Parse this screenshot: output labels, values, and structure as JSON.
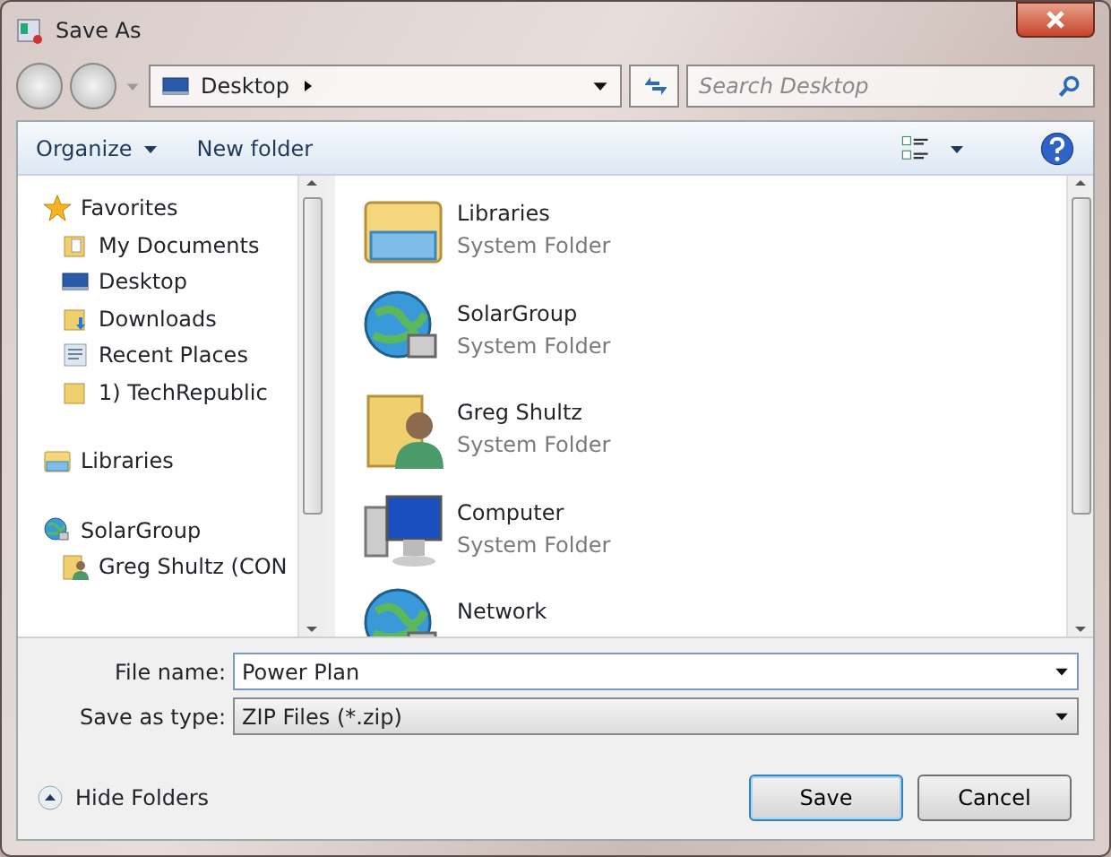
{
  "window": {
    "title": "Save As"
  },
  "address": {
    "location": "Desktop",
    "search_placeholder": "Search Desktop"
  },
  "toolbar": {
    "organize": "Organize",
    "new_folder": "New folder"
  },
  "sidebar": {
    "items": [
      {
        "label": "Favorites",
        "kind": "star",
        "children": [
          {
            "label": "My Documents",
            "kind": "documents"
          },
          {
            "label": "Desktop",
            "kind": "desktop"
          },
          {
            "label": "Downloads",
            "kind": "downloads"
          },
          {
            "label": "Recent Places",
            "kind": "recent"
          },
          {
            "label": "1) TechRepublic",
            "kind": "folder"
          }
        ]
      },
      {
        "label": "Libraries",
        "kind": "library"
      },
      {
        "label": "SolarGroup",
        "kind": "network",
        "children": [
          {
            "label": "Greg Shultz (CON",
            "kind": "user"
          }
        ]
      }
    ]
  },
  "files": [
    {
      "name": "Libraries",
      "type": "System Folder",
      "kind": "library"
    },
    {
      "name": "SolarGroup",
      "type": "System Folder",
      "kind": "network"
    },
    {
      "name": "Greg Shultz",
      "type": "System Folder",
      "kind": "user"
    },
    {
      "name": "Computer",
      "type": "System Folder",
      "kind": "computer"
    },
    {
      "name": "Network",
      "kind": "network"
    }
  ],
  "fields": {
    "file_name_label": "File name:",
    "file_name": "Power Plan",
    "type_label": "Save as type:",
    "type": "ZIP Files (*.zip)"
  },
  "footer": {
    "hide_folders": "Hide Folders",
    "buttons": [
      "Save",
      "Cancel"
    ]
  }
}
